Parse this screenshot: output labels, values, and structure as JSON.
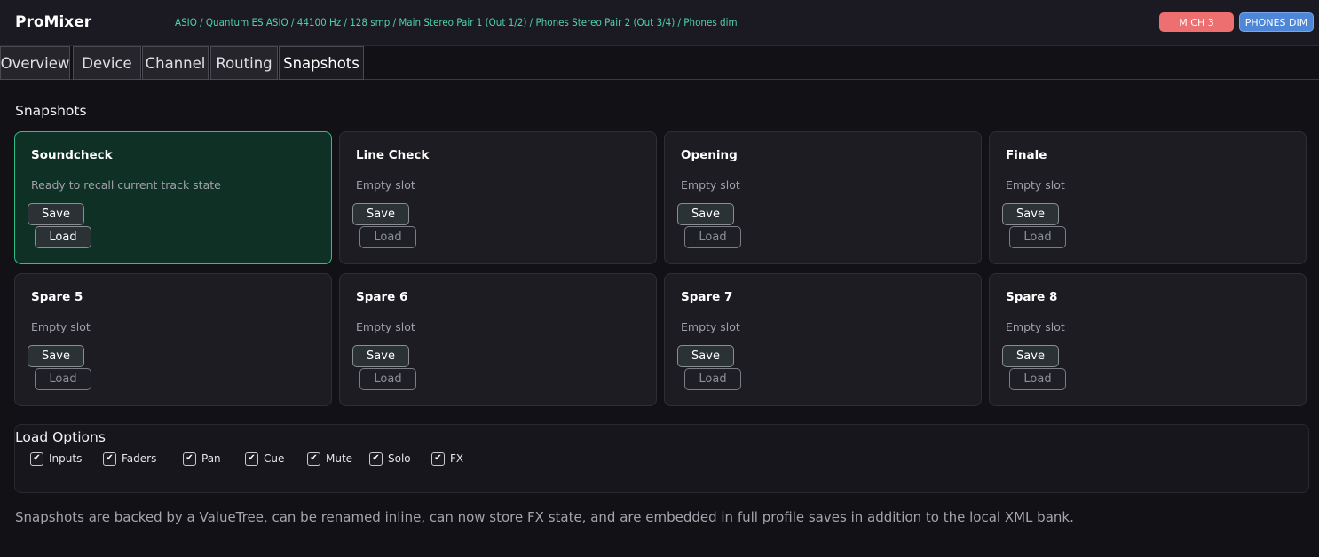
{
  "app": {
    "title": "ProMixer",
    "status": "ASIO / Quantum ES ASIO / 44100 Hz / 128 smp / Main Stereo Pair 1 (Out 1/2) / Phones Stereo Pair 2 (Out 3/4) / Phones dim",
    "badges": {
      "mch": "M CH 3",
      "phones": "PHONES DIM"
    }
  },
  "tabs": [
    {
      "label": "Overview",
      "active": false
    },
    {
      "label": "Device",
      "active": false
    },
    {
      "label": "Channel",
      "active": false
    },
    {
      "label": "Routing",
      "active": false
    },
    {
      "label": "Snapshots",
      "active": true
    }
  ],
  "snapshots": {
    "title": "Snapshots",
    "save_label": "Save",
    "load_label": "Load",
    "slots": [
      {
        "name": "Soundcheck",
        "status": "Ready to recall current track state",
        "selected": true
      },
      {
        "name": "Line Check",
        "status": "Empty slot",
        "selected": false
      },
      {
        "name": "Opening",
        "status": "Empty slot",
        "selected": false
      },
      {
        "name": "Finale",
        "status": "Empty slot",
        "selected": false
      },
      {
        "name": "Spare 5",
        "status": "Empty slot",
        "selected": false
      },
      {
        "name": "Spare 6",
        "status": "Empty slot",
        "selected": false
      },
      {
        "name": "Spare 7",
        "status": "Empty slot",
        "selected": false
      },
      {
        "name": "Spare 8",
        "status": "Empty slot",
        "selected": false
      }
    ]
  },
  "load_options": {
    "title": "Load Options",
    "options": [
      {
        "label": "Inputs",
        "checked": true
      },
      {
        "label": "Faders",
        "checked": true
      },
      {
        "label": "Pan",
        "checked": true
      },
      {
        "label": "Cue",
        "checked": true
      },
      {
        "label": "Mute",
        "checked": true
      },
      {
        "label": "Solo",
        "checked": true
      },
      {
        "label": "FX",
        "checked": true
      }
    ]
  },
  "footnote": "Snapshots are backed by a ValueTree, can be renamed inline, can now store FX state, and are embedded in full profile saves in addition to the local XML bank.",
  "colors": {
    "accent_green": "#2fbf86",
    "status_text": "#4fd1a5",
    "badge_red": "#ee6f6f",
    "badge_blue": "#4e86d8"
  }
}
